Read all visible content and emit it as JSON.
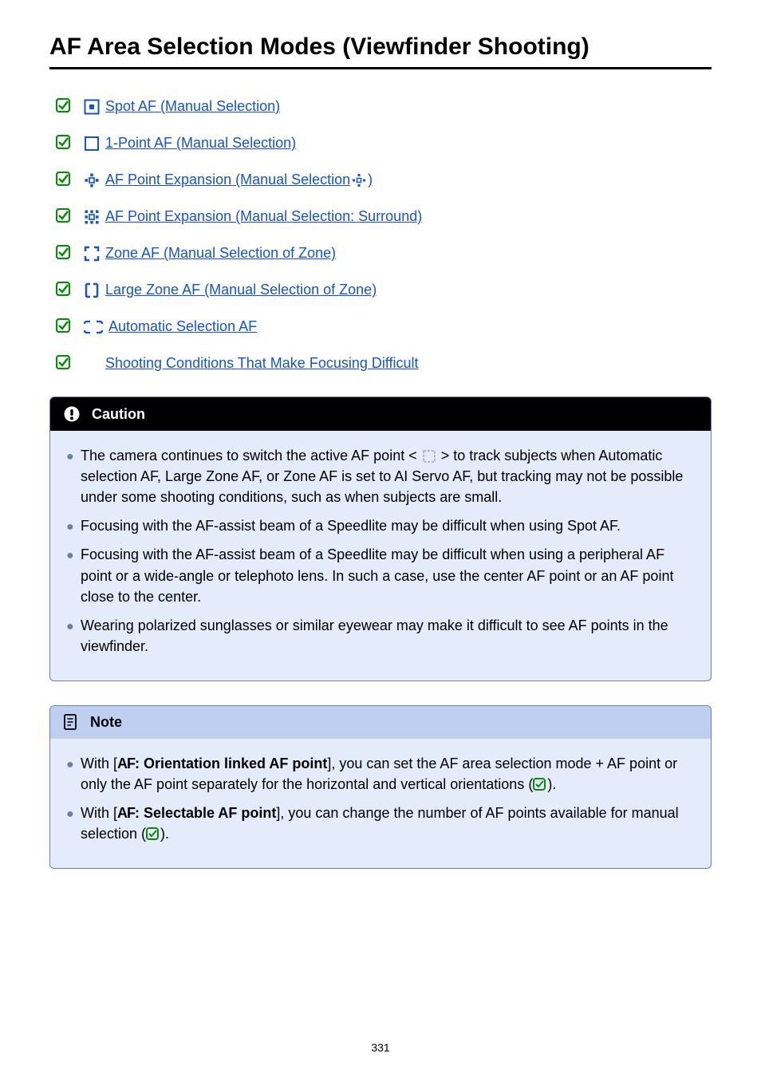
{
  "title": "AF Area Selection Modes (Viewfinder Shooting)",
  "links": [
    {
      "label": " Spot AF (Manual Selection)"
    },
    {
      "label": " 1-Point AF (Manual Selection)"
    },
    {
      "label": " AF Point Expansion (Manual Selection ",
      "trailing_label": ")"
    },
    {
      "label": " AF Point Expansion (Manual Selection: Surround)"
    },
    {
      "label": " Zone AF (Manual Selection of Zone)"
    },
    {
      "label": " Large Zone AF (Manual Selection of Zone)"
    },
    {
      "label": " Automatic Selection AF"
    },
    {
      "label": "Shooting Conditions That Make Focusing Difficult"
    }
  ],
  "caution": {
    "title": "Caution",
    "bullets": [
      {
        "pre": "The camera continues to switch the active AF point < ",
        "post": " > to track subjects when Automatic selection AF, Large Zone AF, or Zone AF is set to AI Servo AF, but tracking may not be possible under some shooting conditions, such as when subjects are small."
      },
      {
        "text": "Focusing with the AF-assist beam of a Speedlite may be difficult when using Spot AF."
      },
      {
        "text": "Focusing with the AF-assist beam of a Speedlite may be difficult when using a peripheral AF point or a wide-angle or telephoto lens. In such a case, use the center AF point or an AF point close to the center."
      },
      {
        "text": "Wearing polarized sunglasses or similar eyewear may make it difficult to see AF points in the viewfinder."
      }
    ]
  },
  "note": {
    "title": "Note",
    "bullets": [
      {
        "pre": "With [",
        "mid": ": Orientation linked AF point",
        "post1": "], you can set the AF area selection mode + AF point or only the AF point separately for the horizontal and vertical orientations (",
        "post2": ")."
      },
      {
        "pre": "With [",
        "mid": ": Selectable AF point",
        "post1": "], you can change the number of AF points available for manual selection (",
        "post2": ")."
      }
    ]
  },
  "page_number": "331"
}
